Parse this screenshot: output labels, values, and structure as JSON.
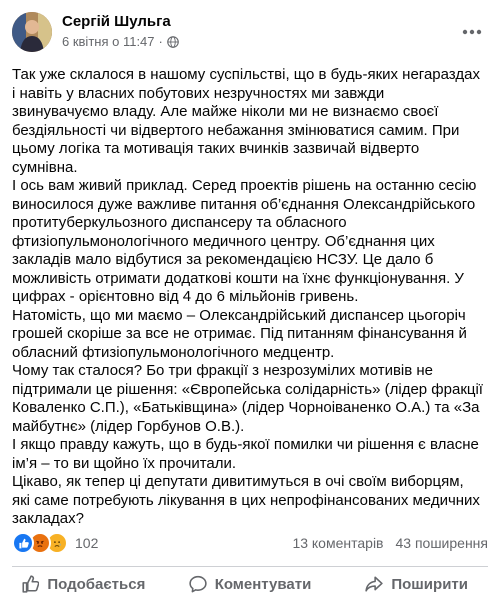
{
  "header": {
    "author": "Сергій Шульга",
    "date": "6 квітня о 11:47",
    "separator": "·"
  },
  "icons": {
    "privacy": "globe-icon",
    "more": "more-options-icon",
    "like": "thumbs-up-icon",
    "comment": "comment-bubble-icon",
    "share": "share-arrow-icon"
  },
  "colors": {
    "like_reaction": "#1877f2",
    "angry_reaction": "#e9710f",
    "sad_reaction": "#f7b125",
    "meta_text": "#65676b"
  },
  "post": {
    "paragraphs": [
      "Так уже склалося в нашому суспільстві, що в будь-яких негараздах і навіть у власних побутових незручностях ми завжди звинувачуємо владу.  Але майже ніколи ми не визнаємо своєї бездіяльності чи відвертого небажання змінюватися самим. При цьому логіка та мотивація таких вчинків зазвичай відверто сумнівна.",
      "І ось вам живий приклад. Серед проектів рішень на останню сесію виносилося дуже важливе питання об’єднання Олександрійського протитуберкульозного диспансеру та обласного фтизіопульмонологічного медичного центру. Об’єднання цих закладів мало відбутися за рекомендацією НСЗУ. Це дало б можливість отримати додаткові кошти на їхнє функціонування. У цифрах - орієнтовно від 4 до 6 мільйонів гривень.",
      "Натомість, що ми маємо – Олександрійський диспансер цьогоріч грошей скоріше за все не отримає. Під питанням фінансування й обласний фтизіопульмонологічного медцентр.",
      "Чому так сталося? Бо три фракції з незрозумілих мотивів не підтримали це рішення: «Європейська солідарність» (лідер фракції Коваленко С.П.), «Батьківщина» (лідер Чорноіваненко О.А.) та «За майбутнє» (лідер Горбунов О.В.).",
      "І якщо правду кажуть, що в будь-якої помилки чи рішення є власне ім’я – то ви щойно їх прочитали.",
      "Цікаво, як тепер ці депутати дивитимуться в очі своїм виборцям, які саме потребують лікування в цих непрофінансованих медичних закладах?"
    ]
  },
  "stats": {
    "reactions_count": "102",
    "comments": "13 коментарів",
    "shares": "43 поширення"
  },
  "actions": {
    "like": "Подобається",
    "comment": "Коментувати",
    "share": "Поширити"
  }
}
